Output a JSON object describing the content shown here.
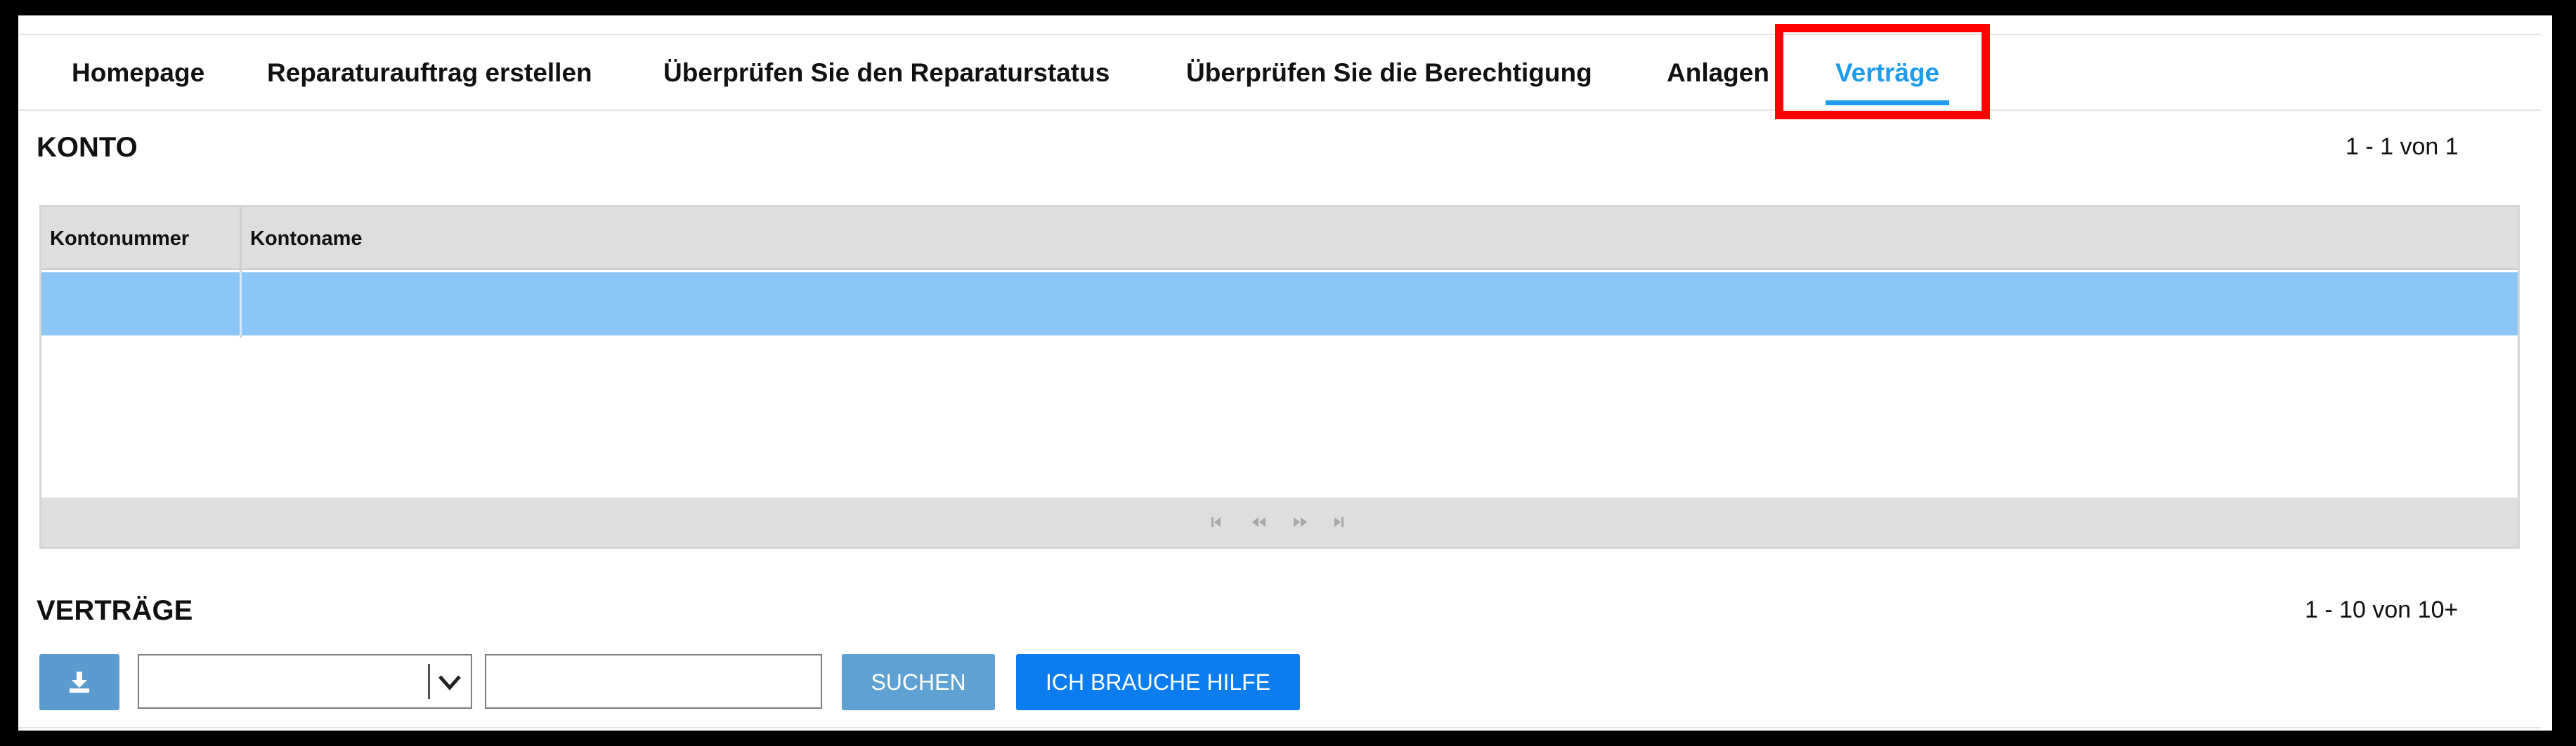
{
  "nav": {
    "items": [
      {
        "label": "Homepage"
      },
      {
        "label": "Reparaturauftrag erstellen"
      },
      {
        "label": "Überprüfen Sie den Reparaturstatus"
      },
      {
        "label": "Überprüfen Sie die Berechtigung"
      },
      {
        "label": "Anlagen"
      },
      {
        "label": "Verträge",
        "active": true
      }
    ]
  },
  "konto": {
    "title": "KONTO",
    "pager": "1 - 1 von 1",
    "columns": [
      "Kontonummer",
      "Kontoname"
    ],
    "rows": [
      {
        "kontonummer": "",
        "kontoname": "",
        "selected": true
      }
    ]
  },
  "vertraege": {
    "title": "VERTRÄGE",
    "pager": "1 - 10 von 10+",
    "select_value": "",
    "search_value": "",
    "search_button": "SUCHEN",
    "help_button": "ICH BRAUCHE HILFE"
  },
  "icons": {
    "download": "download-icon",
    "first": "first-page-icon",
    "prev": "previous-page-icon",
    "next": "next-page-icon",
    "last": "last-page-icon",
    "chevron": "chevron-down-icon"
  },
  "colors": {
    "accent": "#1e9bea",
    "highlight": "#ff0000",
    "selected_row": "#8cc6f6",
    "primary_button": "#0b7def",
    "secondary_button": "#5ea1d3"
  }
}
